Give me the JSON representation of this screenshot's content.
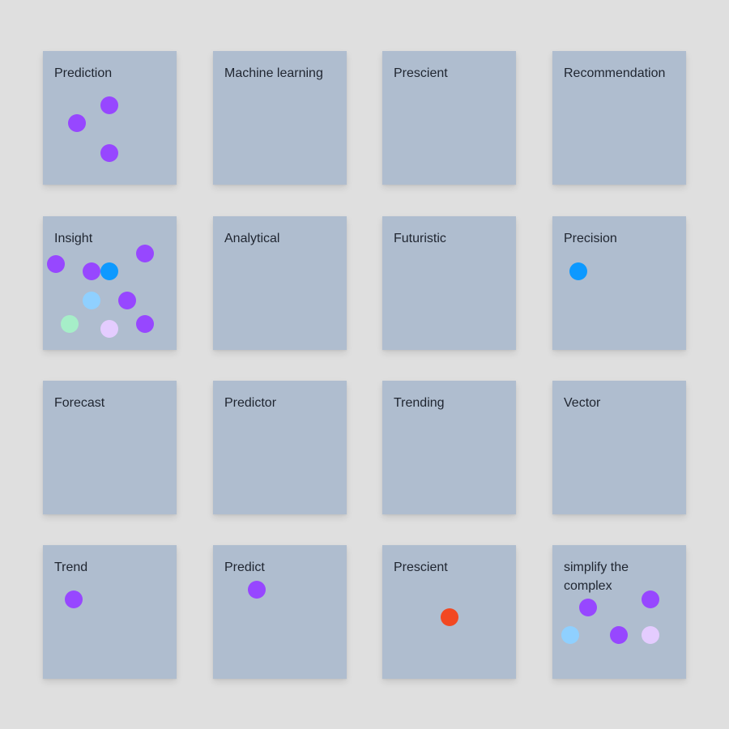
{
  "board": {
    "colors": {
      "background": "#dfdfdf",
      "sticky": "#afbdcf",
      "text": "#1f2530"
    },
    "dot_colors": {
      "purple": "#9747ff",
      "blue": "#0d99ff",
      "light-blue": "#8fd0ff",
      "mint": "#a6eec8",
      "lavender": "#e4ccff",
      "red": "#f24822"
    },
    "notes": [
      {
        "label": "Prediction",
        "dots": [
          {
            "color": "purple"
          },
          {
            "color": "purple"
          },
          {
            "color": "purple"
          }
        ]
      },
      {
        "label": "Machine learning",
        "dots": []
      },
      {
        "label": "Prescient",
        "dots": []
      },
      {
        "label": "Recommendation",
        "dots": []
      },
      {
        "label": "Insight",
        "dots": [
          {
            "color": "purple"
          },
          {
            "color": "purple"
          },
          {
            "color": "purple"
          },
          {
            "color": "blue"
          },
          {
            "color": "light-blue"
          },
          {
            "color": "purple"
          },
          {
            "color": "mint"
          },
          {
            "color": "lavender"
          },
          {
            "color": "purple"
          }
        ]
      },
      {
        "label": "Analytical",
        "dots": []
      },
      {
        "label": "Futuristic",
        "dots": []
      },
      {
        "label": "Precision",
        "dots": [
          {
            "color": "blue"
          }
        ]
      },
      {
        "label": "Forecast",
        "dots": []
      },
      {
        "label": "Predictor",
        "dots": []
      },
      {
        "label": "Trending",
        "dots": []
      },
      {
        "label": "Vector",
        "dots": []
      },
      {
        "label": "Trend",
        "dots": [
          {
            "color": "purple"
          }
        ]
      },
      {
        "label": "Predict",
        "dots": [
          {
            "color": "purple"
          }
        ]
      },
      {
        "label": "Prescient",
        "dots": [
          {
            "color": "red"
          }
        ]
      },
      {
        "label": "simplify the complex",
        "dots": [
          {
            "color": "purple"
          },
          {
            "color": "purple"
          },
          {
            "color": "light-blue"
          },
          {
            "color": "purple"
          },
          {
            "color": "lavender"
          }
        ]
      }
    ]
  }
}
